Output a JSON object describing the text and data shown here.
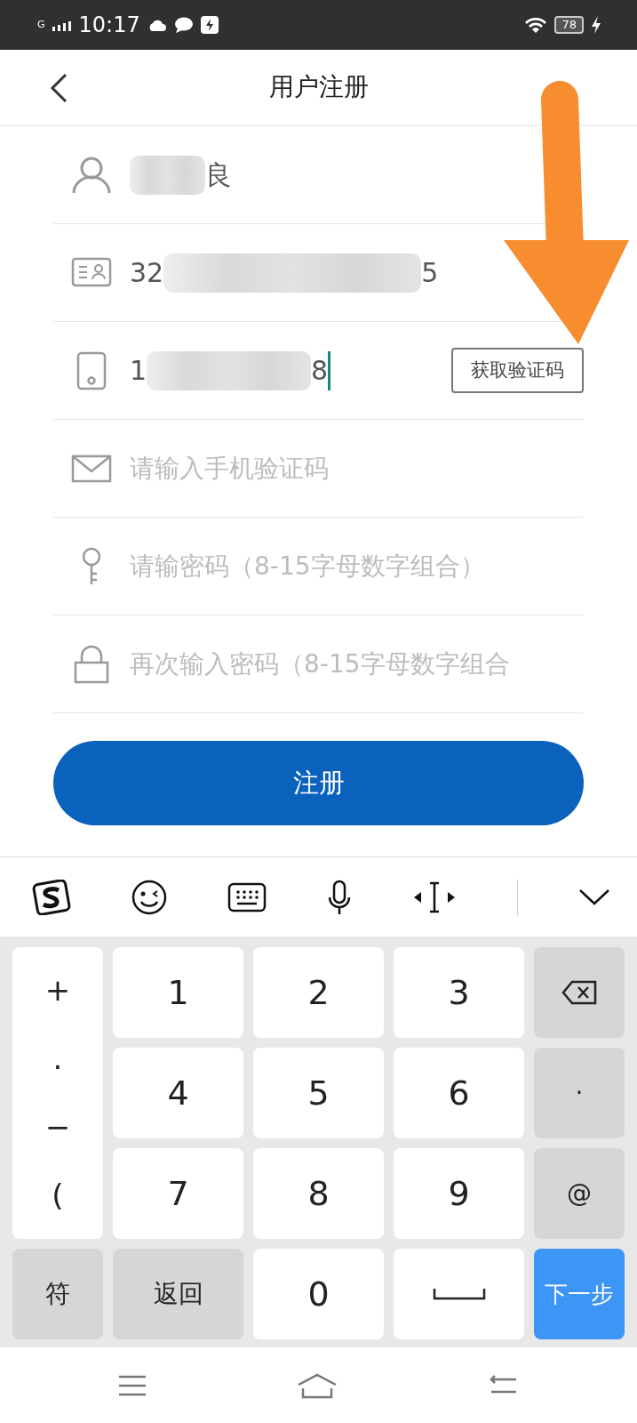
{
  "status_bar": {
    "network": "G",
    "time": "10:17",
    "battery": "78"
  },
  "header": {
    "title": "用户注册"
  },
  "fields": [
    {
      "kind": "name",
      "value_end": "良",
      "masked": true
    },
    {
      "kind": "id",
      "value_start": "32",
      "value_end": "5",
      "masked": true
    },
    {
      "kind": "phone",
      "value_start": "1",
      "value_end": "8",
      "masked": true,
      "focused": true,
      "button": "获取验证码"
    },
    {
      "kind": "code",
      "placeholder": "请输入手机验证码"
    },
    {
      "kind": "password",
      "placeholder": "请输密码（8-15字母数字组合）"
    },
    {
      "kind": "confirm",
      "placeholder": "再次输入密码（8-15字母数字组合"
    }
  ],
  "submit": "注册",
  "keyboard": {
    "symbols": [
      "+",
      ".",
      "−",
      "("
    ],
    "keys": [
      {
        "kind": "digit",
        "label": "1"
      },
      {
        "kind": "digit",
        "label": "2"
      },
      {
        "kind": "digit",
        "label": "3"
      },
      {
        "kind": "delete"
      },
      {
        "kind": "digit",
        "label": "4"
      },
      {
        "kind": "digit",
        "label": "5"
      },
      {
        "kind": "digit",
        "label": "6"
      },
      {
        "kind": "side",
        "label": "·"
      },
      {
        "kind": "digit",
        "label": "7"
      },
      {
        "kind": "digit",
        "label": "8"
      },
      {
        "kind": "digit",
        "label": "9"
      },
      {
        "kind": "side",
        "label": "@"
      },
      {
        "kind": "side",
        "label": "符"
      },
      {
        "kind": "side",
        "label": "返回"
      },
      {
        "kind": "digit",
        "label": "0"
      },
      {
        "kind": "space"
      },
      {
        "kind": "action",
        "label": "下一步"
      }
    ]
  }
}
